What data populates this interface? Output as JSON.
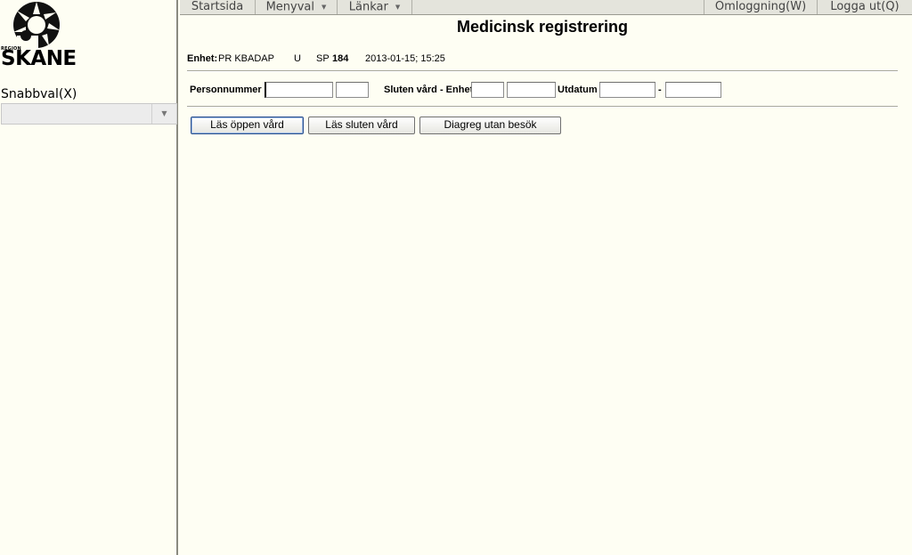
{
  "sidebar": {
    "logo": {
      "region_text": "REGION",
      "name_text": "SKANE"
    },
    "quick_label": "Snabbval(X)",
    "quick_select_value": ""
  },
  "menubar": {
    "items": [
      {
        "label": "Startsida"
      },
      {
        "label": "Menyval"
      },
      {
        "label": "Länkar"
      },
      {
        "label": "Omloggning(W)"
      },
      {
        "label": "Logga ut(Q)"
      }
    ]
  },
  "page": {
    "title": "Medicinsk registrering",
    "unit_label": "Enhet:",
    "unit_value": "PR KBADAP",
    "unit_code": "U",
    "sp_label": "SP",
    "sp_value": "184",
    "datetime": "2013-01-15; 15:25"
  },
  "form": {
    "personnummer_label": "Personnummer",
    "sluten_label": "Sluten vård - Enhet",
    "utdatum_label": "Utdatum",
    "dash": "-",
    "values": {
      "pnr1": "",
      "pnr2": "",
      "enhet1": "",
      "enhet2": "",
      "utdatum_from": "",
      "utdatum_to": ""
    }
  },
  "buttons": {
    "open_care": "Läs öppen vård",
    "closed_care": "Läs sluten vård",
    "diag_no_visit": "Diagreg utan besök"
  },
  "colors": {
    "background": "#fefef3",
    "menubar": "#e4e4dc",
    "focus": "#2a4f8c"
  }
}
